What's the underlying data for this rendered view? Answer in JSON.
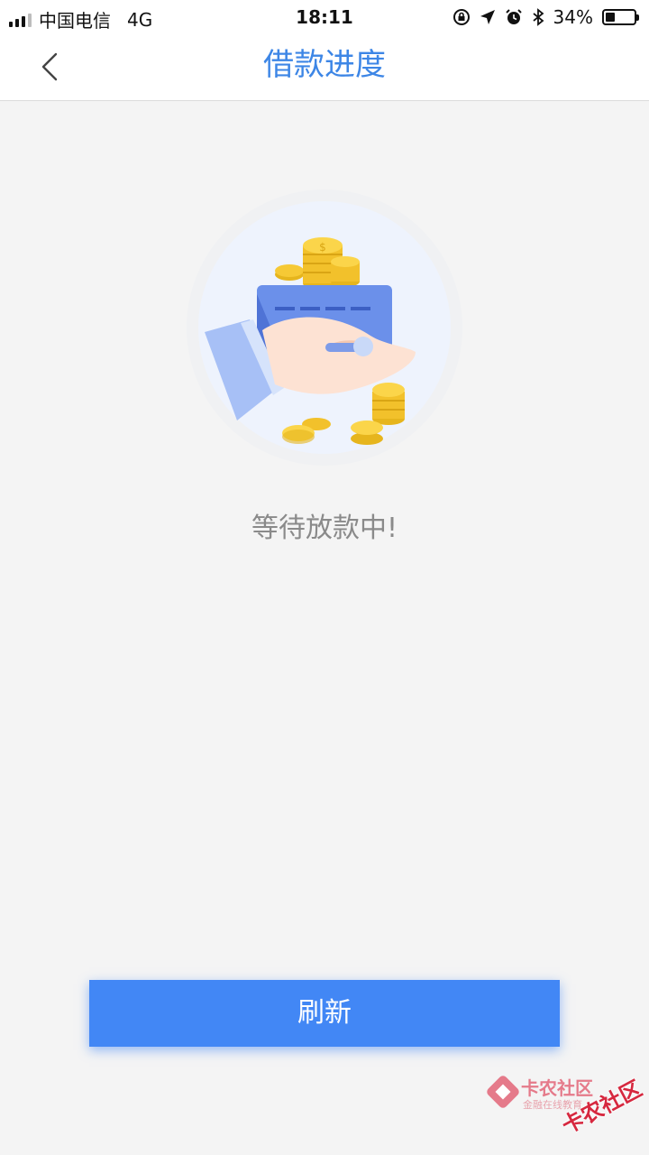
{
  "status_bar": {
    "carrier": "中国电信",
    "network": "4G",
    "time": "18:11",
    "battery_text": "34%",
    "battery_level": 0.34,
    "icons": [
      "orientation-lock-icon",
      "location-arrow-icon",
      "alarm-icon",
      "bluetooth-icon"
    ]
  },
  "nav": {
    "title": "借款进度",
    "back_icon": "chevron-left-icon",
    "title_color": "#3d86e6"
  },
  "illustration": {
    "icon": "hand-holding-card-with-coins",
    "coin_symbol": "$"
  },
  "main": {
    "status_text": "等待放款中!"
  },
  "actions": {
    "refresh_label": "刷新",
    "accent_color": "#4287f5"
  },
  "watermark": {
    "title": "卡农社区",
    "subtitle": "金融在线教育",
    "stamp_text": "卡农社区"
  }
}
